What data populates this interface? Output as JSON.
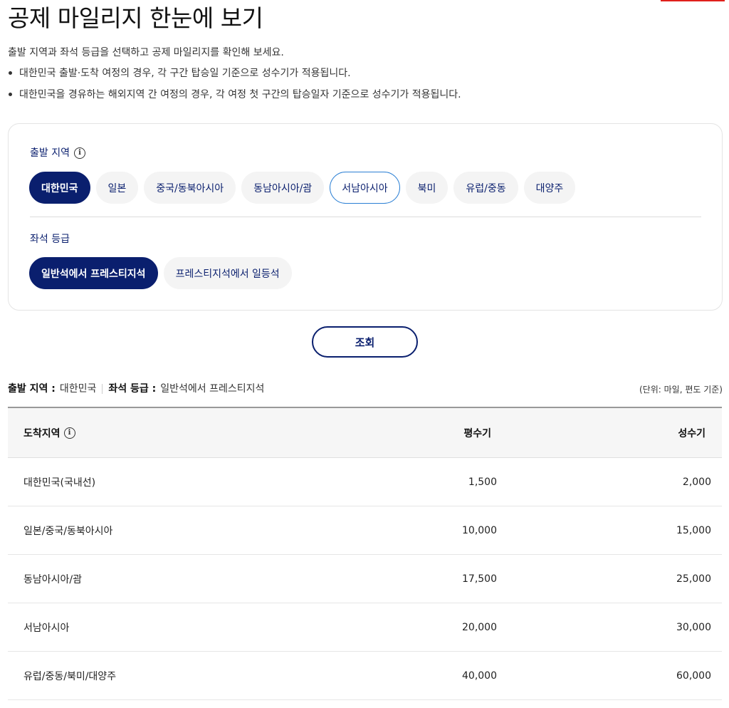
{
  "page": {
    "title": "공제 마일리지 한눈에 보기",
    "intro": "출발 지역과 좌석 등급을 선택하고 공제 마일리지를 확인해 보세요.",
    "notes": [
      "대한민국 출발·도착 여정의 경우, 각 구간 탑승일 기준으로 성수기가 적용됩니다.",
      "대한민국을 경유하는 해외지역 간 여정의 경우, 각 여정 첫 구간의 탑승일자 기준으로 성수기가 적용됩니다."
    ]
  },
  "filters": {
    "region_label": "출발 지역",
    "regions": [
      "대한민국",
      "일본",
      "중국/동북아시아",
      "동남아시아/괌",
      "서남아시아",
      "북미",
      "유럽/중동",
      "대양주"
    ],
    "selected_region": "대한민국",
    "class_label": "좌석 등급",
    "classes": [
      "일반석에서 프레스티지석",
      "프레스티지석에서 일등석"
    ],
    "selected_class": "일반석에서 프레스티지석"
  },
  "search_button": "조회",
  "summary": {
    "region_key": "출발 지역 :",
    "region_value": "대한민국",
    "class_key": "좌석 등급 :",
    "class_value": "일반석에서 프레스티지석",
    "unit_note": "(단위: 마일, 편도 기준)"
  },
  "table": {
    "headers": {
      "destination": "도착지역",
      "off_peak": "평수기",
      "peak": "성수기"
    },
    "rows": [
      {
        "destination": "대한민국(국내선)",
        "off_peak": "1,500",
        "peak": "2,000"
      },
      {
        "destination": "일본/중국/동북아시아",
        "off_peak": "10,000",
        "peak": "15,000"
      },
      {
        "destination": "동남아시아/괌",
        "off_peak": "17,500",
        "peak": "25,000"
      },
      {
        "destination": "서남아시아",
        "off_peak": "20,000",
        "peak": "30,000"
      },
      {
        "destination": "유럽/중동/북미/대양주",
        "off_peak": "40,000",
        "peak": "60,000"
      }
    ]
  },
  "colors": {
    "brand_navy": "#0a1f6e",
    "focus_blue": "#2a7fd4",
    "accent_red": "#e0201b"
  }
}
